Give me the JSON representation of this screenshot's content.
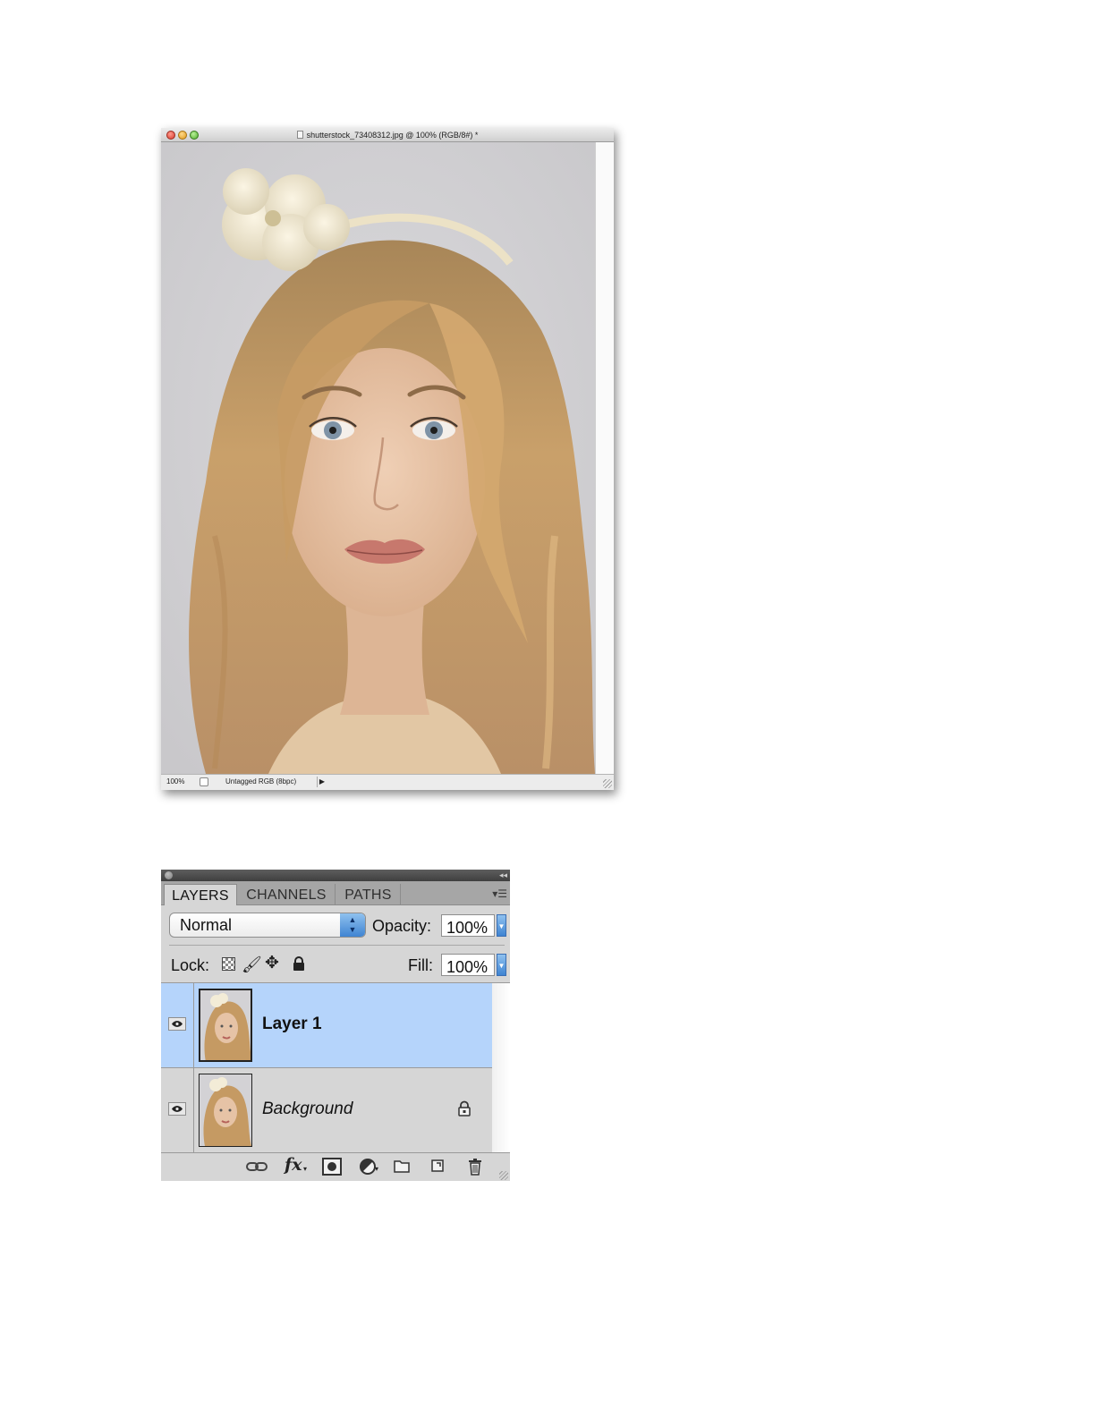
{
  "document_window": {
    "title": "shutterstock_73408312.jpg @ 100% (RGB/8#) *",
    "image_description": "",
    "status": {
      "zoom": "100%",
      "doc_info": "Untagged RGB (8bpc)",
      "arrow": "▶"
    }
  },
  "layers_panel": {
    "tabs": [
      {
        "label": "LAYERS",
        "active": true
      },
      {
        "label": "CHANNELS",
        "active": false
      },
      {
        "label": "PATHS",
        "active": false
      }
    ],
    "menu_icon": "▾☰",
    "blend_mode": "Normal",
    "opacity_label": "Opacity:",
    "opacity_value": "100%",
    "lock_label": "Lock:",
    "fill_label": "Fill:",
    "fill_value": "100%",
    "layers": [
      {
        "name": "Layer 1",
        "selected": true,
        "visible": true,
        "locked": false
      },
      {
        "name": "Background",
        "selected": false,
        "visible": true,
        "locked": true
      }
    ],
    "bottom_icons": [
      "link-layers-icon",
      "fx-icon",
      "layer-mask-icon",
      "adjustment-layer-icon",
      "group-folder-icon",
      "new-layer-icon",
      "trash-icon"
    ],
    "fx_label": "fx"
  },
  "colors": {
    "selected_row": "#b5d4fb",
    "panel_bg": "#d6d6d6",
    "accent_blue": "#3f84d2"
  }
}
